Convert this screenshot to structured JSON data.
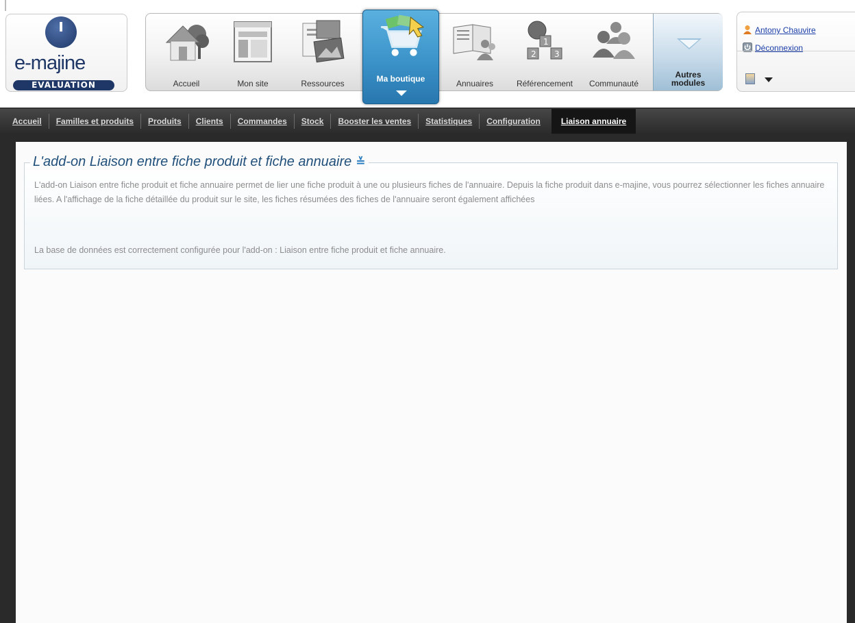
{
  "app": {
    "logo_text": "e-majine",
    "logo_badge": "EVALUATION",
    "logo_icon": "dog-head-logo"
  },
  "modules": [
    {
      "label": "Accueil",
      "icon": "house-tree-icon"
    },
    {
      "label": "Mon site",
      "icon": "website-layout-icon"
    },
    {
      "label": "Ressources",
      "icon": "documents-image-icon"
    },
    {
      "label": "Ma boutique",
      "icon": "shopping-cart-icon",
      "active": true
    },
    {
      "label": "Annuaires",
      "icon": "book-people-icon"
    },
    {
      "label": "Référencement",
      "icon": "award-ranking-icon"
    },
    {
      "label": "Communauté",
      "icon": "people-group-icon"
    }
  ],
  "autres_modules": {
    "line1": "Autres",
    "line2": "modules"
  },
  "user": {
    "name": "Antony Chauvire",
    "logout": "Déconnexion"
  },
  "subnav": [
    "Accueil",
    "Familles et produits",
    "Produits",
    "Clients",
    "Commandes",
    "Stock",
    "Booster les ventes",
    "Statistiques",
    "Configuration",
    "Liaison annuaire"
  ],
  "subnav_active": "Liaison annuaire",
  "info": {
    "title": "L'add-on Liaison entre fiche produit et fiche annuaire",
    "description": "L'add-on Liaison entre fiche produit et fiche annuaire permet de lier une fiche produit à une ou plusieurs fiches de l'annuaire. Depuis la fiche produit dans e-majine, vous pourrez sélectionner les fiches annuaire liées. A l'affichage de la fiche détaillée du produit sur le site, les fiches résumées des fiches de l'annuaire seront également affichées",
    "status": "La base de données est correctement configurée pour l'add-on : Liaison entre fiche produit et fiche annuaire."
  },
  "colors": {
    "accent_blue": "#3b93c9",
    "title_blue": "#1f4f7a",
    "link_blue": "#1a3da8",
    "subnav_bg": "#2b2b2b"
  }
}
